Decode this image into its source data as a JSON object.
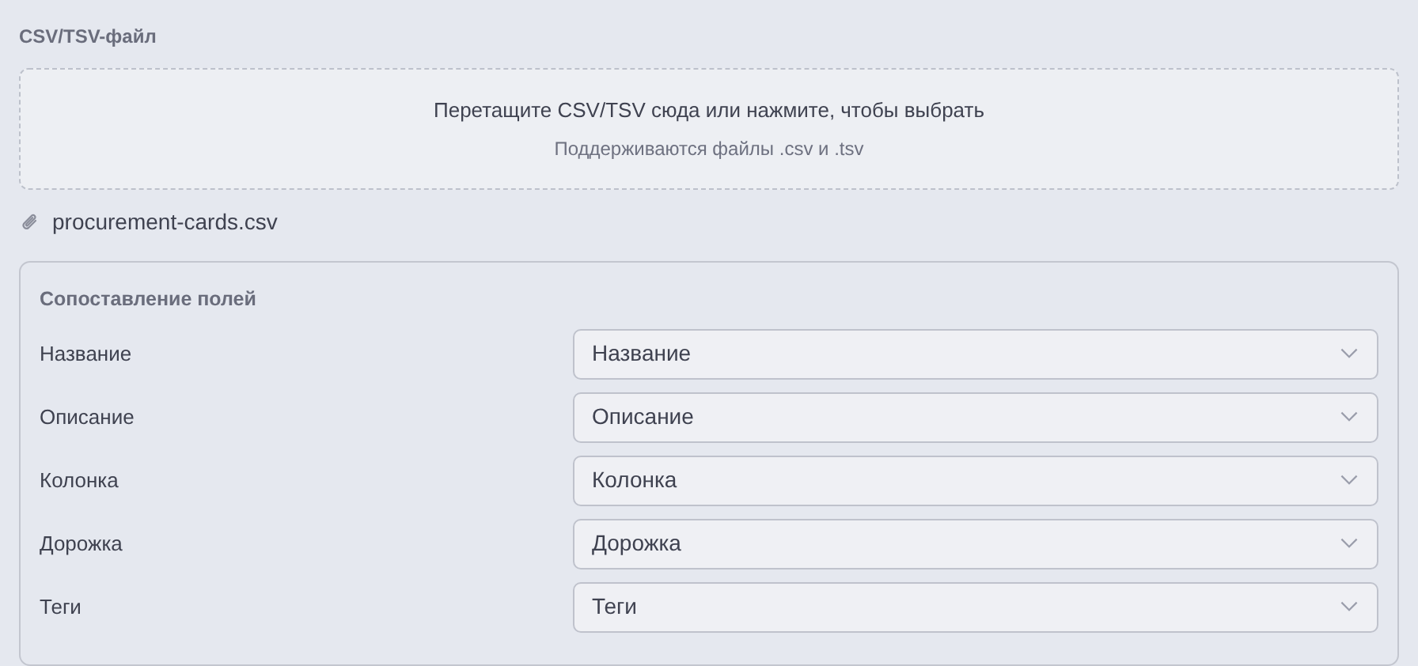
{
  "upload": {
    "title": "CSV/TSV-файл",
    "dropzone": {
      "prompt": "Перетащите CSV/TSV сюда или нажмите, чтобы выбрать",
      "hint": "Поддерживаются файлы .csv и .tsv"
    },
    "file_name": "procurement-cards.csv"
  },
  "mapping": {
    "title": "Сопоставление полей",
    "rows": [
      {
        "label": "Название",
        "value": "Название"
      },
      {
        "label": "Описание",
        "value": "Описание"
      },
      {
        "label": "Колонка",
        "value": "Колонка"
      },
      {
        "label": "Дорожка",
        "value": "Дорожка"
      },
      {
        "label": "Теги",
        "value": "Теги"
      }
    ]
  }
}
